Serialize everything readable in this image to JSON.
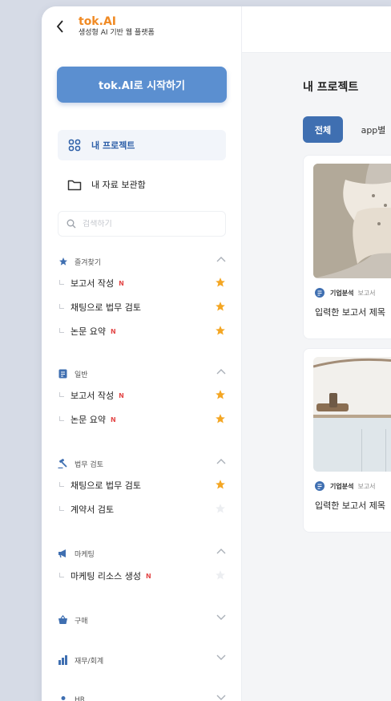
{
  "app": {
    "name": "tok.AI",
    "tagline": "생성형 AI 기반 웹 플랫폼"
  },
  "sidebar": {
    "start_button": "tok.AI로 시작하기",
    "nav": [
      {
        "label": "내 프로젝트",
        "icon": "grid-icon",
        "active": true
      },
      {
        "label": "내 자료 보관함",
        "icon": "folder-icon",
        "active": false
      }
    ],
    "search": {
      "placeholder": "검색하기",
      "value": ""
    },
    "categories": [
      {
        "label": "즐겨찾기",
        "icon": "star-icon",
        "expanded": true,
        "items": [
          {
            "label": "보고서 작성",
            "new": "N"
          },
          {
            "label": "채팅으로 법무 검토",
            "new": ""
          },
          {
            "label": "논문 요약",
            "new": "N"
          }
        ]
      },
      {
        "label": "일반",
        "icon": "document-icon",
        "expanded": true,
        "items": [
          {
            "label": "보고서 작성",
            "new": "N"
          },
          {
            "label": "논문 요약",
            "new": "N"
          }
        ]
      },
      {
        "label": "법무 검토",
        "icon": "gavel-icon",
        "expanded": true,
        "items": [
          {
            "label": "채팅으로 법무 검토",
            "new": ""
          },
          {
            "label": "계약서 검토",
            "new": ""
          }
        ]
      },
      {
        "label": "마케팅",
        "icon": "megaphone-icon",
        "expanded": true,
        "items": [
          {
            "label": "마케팅 리소스 생성",
            "new": "N"
          }
        ]
      },
      {
        "label": "구매",
        "icon": "basket-icon",
        "expanded": false,
        "items": []
      },
      {
        "label": "재무/회계",
        "icon": "chart-icon",
        "expanded": false,
        "items": []
      },
      {
        "label": "HR",
        "icon": "person-icon",
        "expanded": false,
        "items": []
      }
    ]
  },
  "main": {
    "title": "내 프로젝트",
    "tabs": [
      {
        "label": "전체",
        "active": true
      },
      {
        "label": "app별",
        "active": false
      }
    ],
    "cards": [
      {
        "category": "기업분석",
        "subcategory": "보고서",
        "title": "입력한 보고서 제목"
      },
      {
        "category": "기업분석",
        "subcategory": "보고서",
        "title": "입력한 보고서 제목"
      }
    ]
  },
  "colors": {
    "brand": "#f08a24",
    "primary": "#5b8fd0",
    "tab_active": "#3f6fb1",
    "new_badge": "#e34848",
    "star": "#f4a623"
  }
}
